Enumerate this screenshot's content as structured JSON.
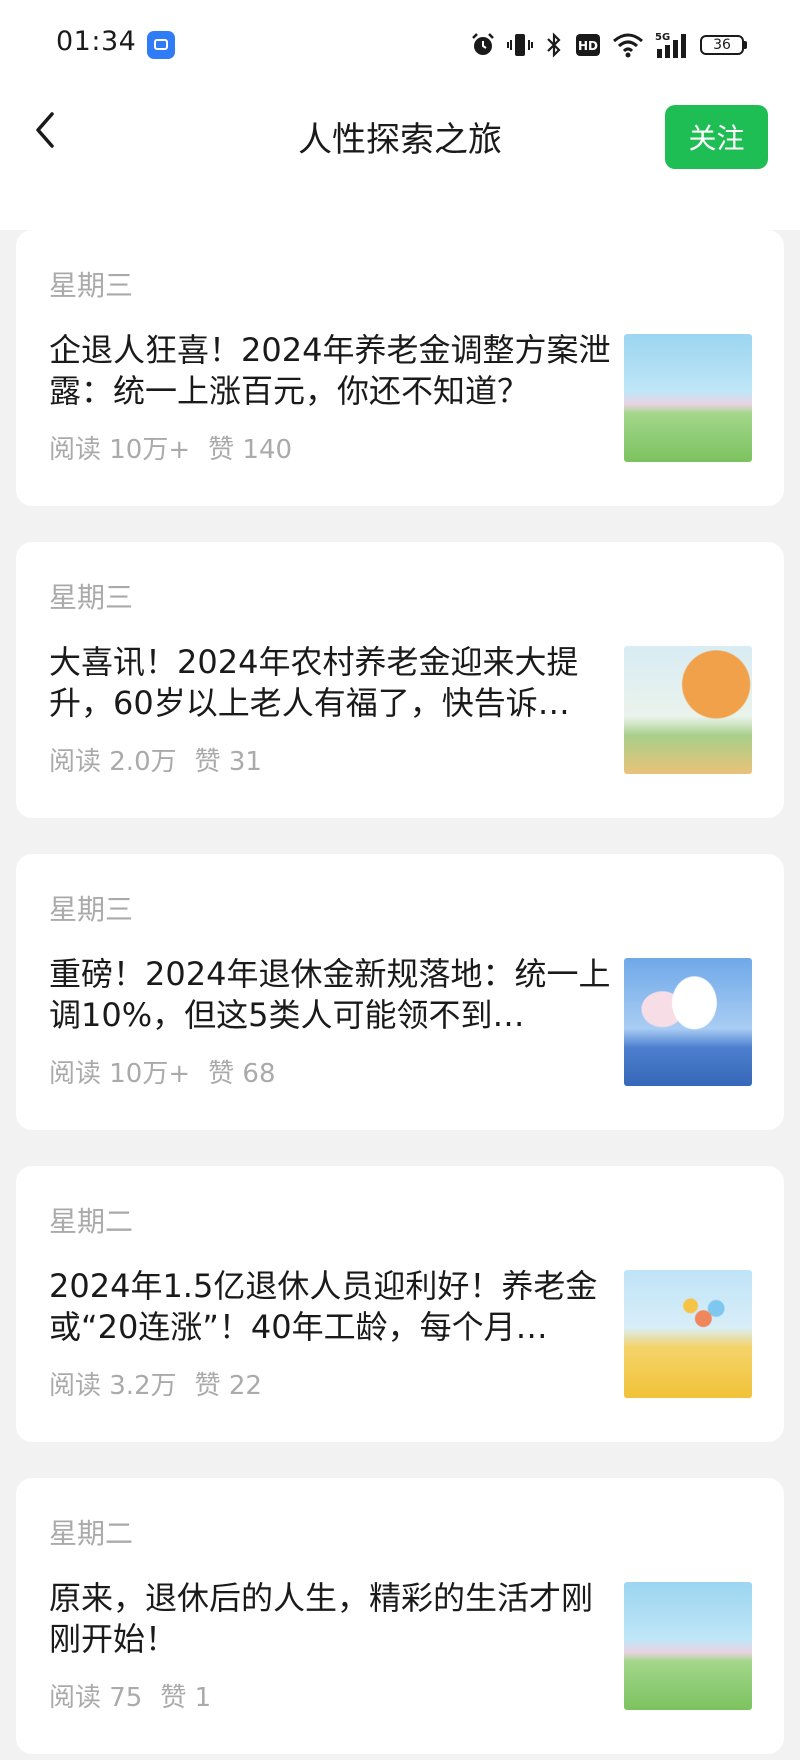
{
  "status_bar": {
    "time": "01:34",
    "app_icon": "app-notification-icon",
    "icons": [
      "alarm-icon",
      "vibrate-icon",
      "bluetooth-icon",
      "hd-icon",
      "wifi-icon",
      "signal-5g-icon",
      "battery-icon"
    ],
    "battery": "36"
  },
  "header": {
    "back_icon": "chevron-left-icon",
    "title": "人性探索之旅",
    "follow_label": "关注",
    "accent_color": "#1fbe55"
  },
  "articles": [
    {
      "date": "星期三",
      "title": "企退人狂喜！2024年养老金调整方案泄露：统一上涨百元，你还不知道？",
      "reads": "阅读 10万+",
      "likes": "赞 140",
      "thumb": "spring-meadow-illustration"
    },
    {
      "date": "星期三",
      "title": "大喜讯！2024年农村养老金迎来大提升，60岁以上老人有福了，快告诉…",
      "reads": "阅读 2.0万",
      "likes": "赞 31",
      "thumb": "autumn-tree-illustration"
    },
    {
      "date": "星期三",
      "title": "重磅！2024年退休金新规落地：统一上调10%，但这5类人可能领不到…",
      "reads": "阅读 10万+",
      "likes": "赞 68",
      "thumb": "clouds-sea-illustration"
    },
    {
      "date": "星期二",
      "title": "2024年1.5亿退休人员迎利好！养老金或“20连涨”！40年工龄，每个月…",
      "reads": "阅读 3.2万",
      "likes": "赞 22",
      "thumb": "balloons-field-illustration"
    },
    {
      "date": "星期二",
      "title": "原来，退休后的人生，精彩的生活才刚刚开始！",
      "reads": "阅读 75",
      "likes": "赞 1",
      "thumb": "spring-meadow-illustration"
    }
  ]
}
